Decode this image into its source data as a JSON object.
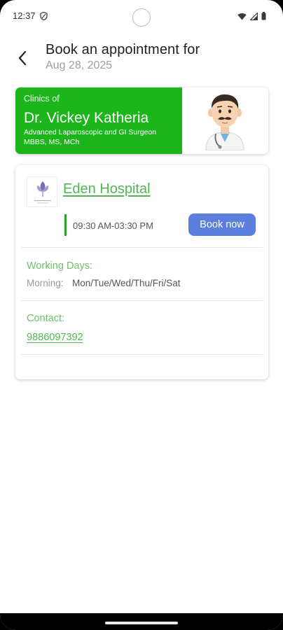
{
  "status_bar": {
    "time": "12:37",
    "icons": [
      "shield-icon",
      "wifi-icon",
      "signal-icon",
      "battery-icon"
    ]
  },
  "header": {
    "title": "Book an appointment for",
    "date": "Aug 28, 2025",
    "back_icon": "back-arrow-icon"
  },
  "doctor": {
    "clinics_of": "Clinics of",
    "name": "Dr. Vickey Katheria",
    "specialty": "Advanced Laparoscopic and GI Surgeon",
    "degrees": "MBBS, MS, MCh",
    "avatar": "doctor-emoji",
    "banner_color": "#1cb51c"
  },
  "clinic": {
    "logo_text": "HEDN CLINIC",
    "name": "Eden Hospital",
    "timing": "09:30 AM-03:30 PM",
    "book_label": "Book now",
    "working_days_label": "Working Days:",
    "morning_label": "Morning:",
    "morning_days": "Mon/Tue/Wed/Thu/Fri/Sat",
    "contact_label": "Contact:",
    "contact_phone": "9886097392",
    "accent_color": "#52b552",
    "button_color": "#5b7fde"
  }
}
